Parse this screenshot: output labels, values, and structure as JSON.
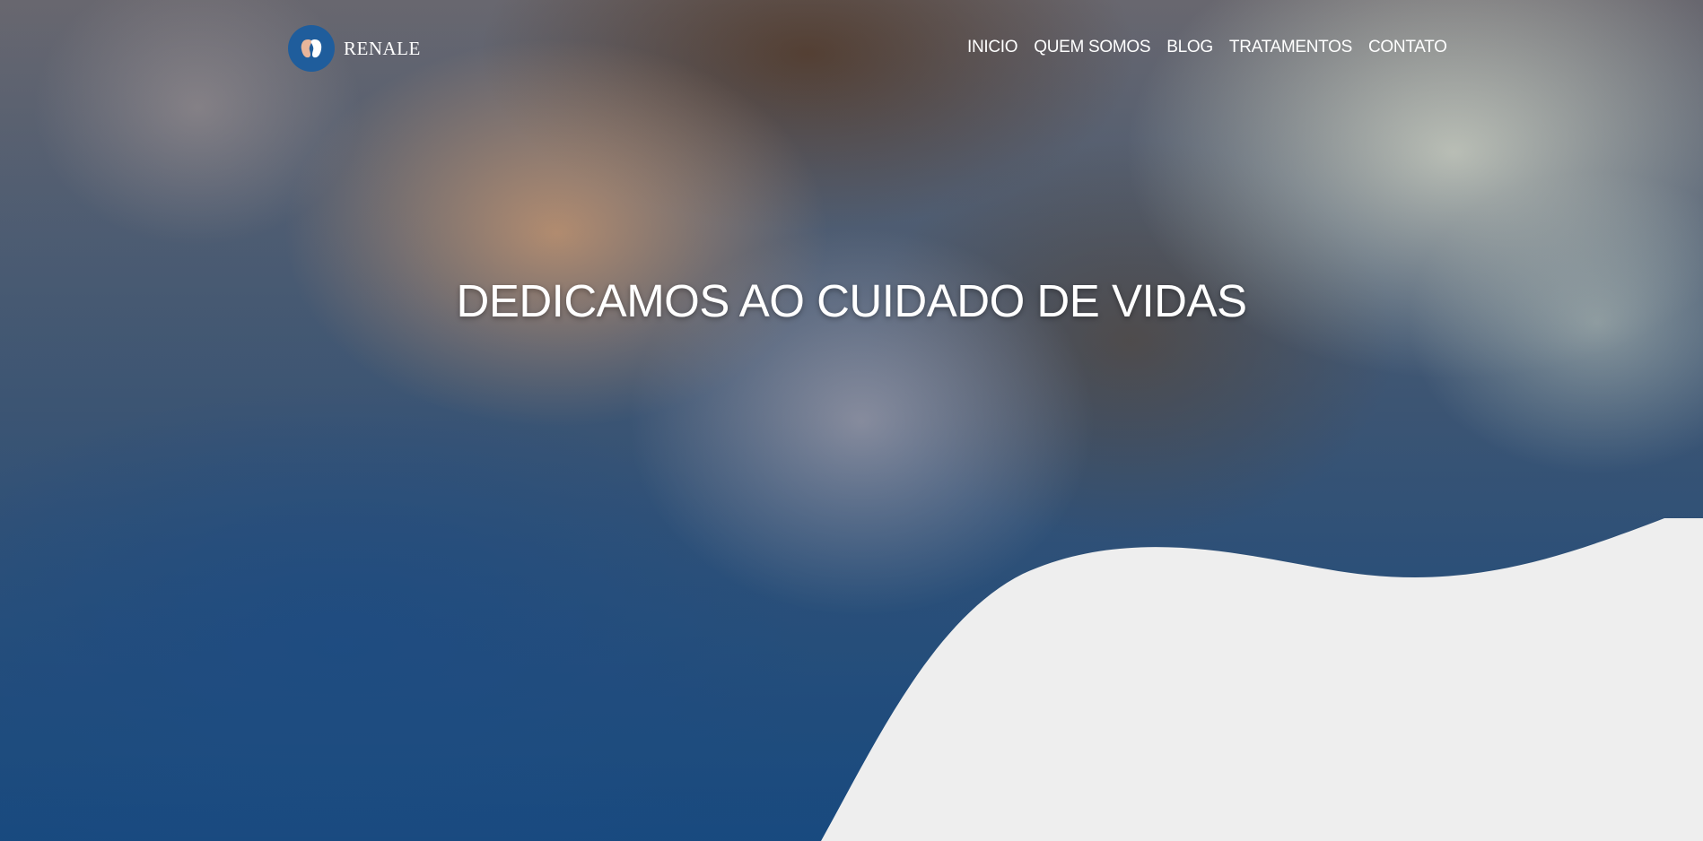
{
  "header": {
    "logo_text": "RENALE",
    "logo_icon": "kidney-icon",
    "nav": [
      {
        "label": "INICIO"
      },
      {
        "label": "QUEM SOMOS"
      },
      {
        "label": "BLOG"
      },
      {
        "label": "TRATAMENTOS"
      },
      {
        "label": "CONTATO"
      }
    ]
  },
  "hero": {
    "headline": "DEDICAMOS AO CUIDADO DE VIDAS",
    "image": "mother-and-child-photo"
  },
  "colors": {
    "brand_blue": "#1f5d9c",
    "wave_fill": "#eeeeee",
    "text": "#ffffff"
  }
}
